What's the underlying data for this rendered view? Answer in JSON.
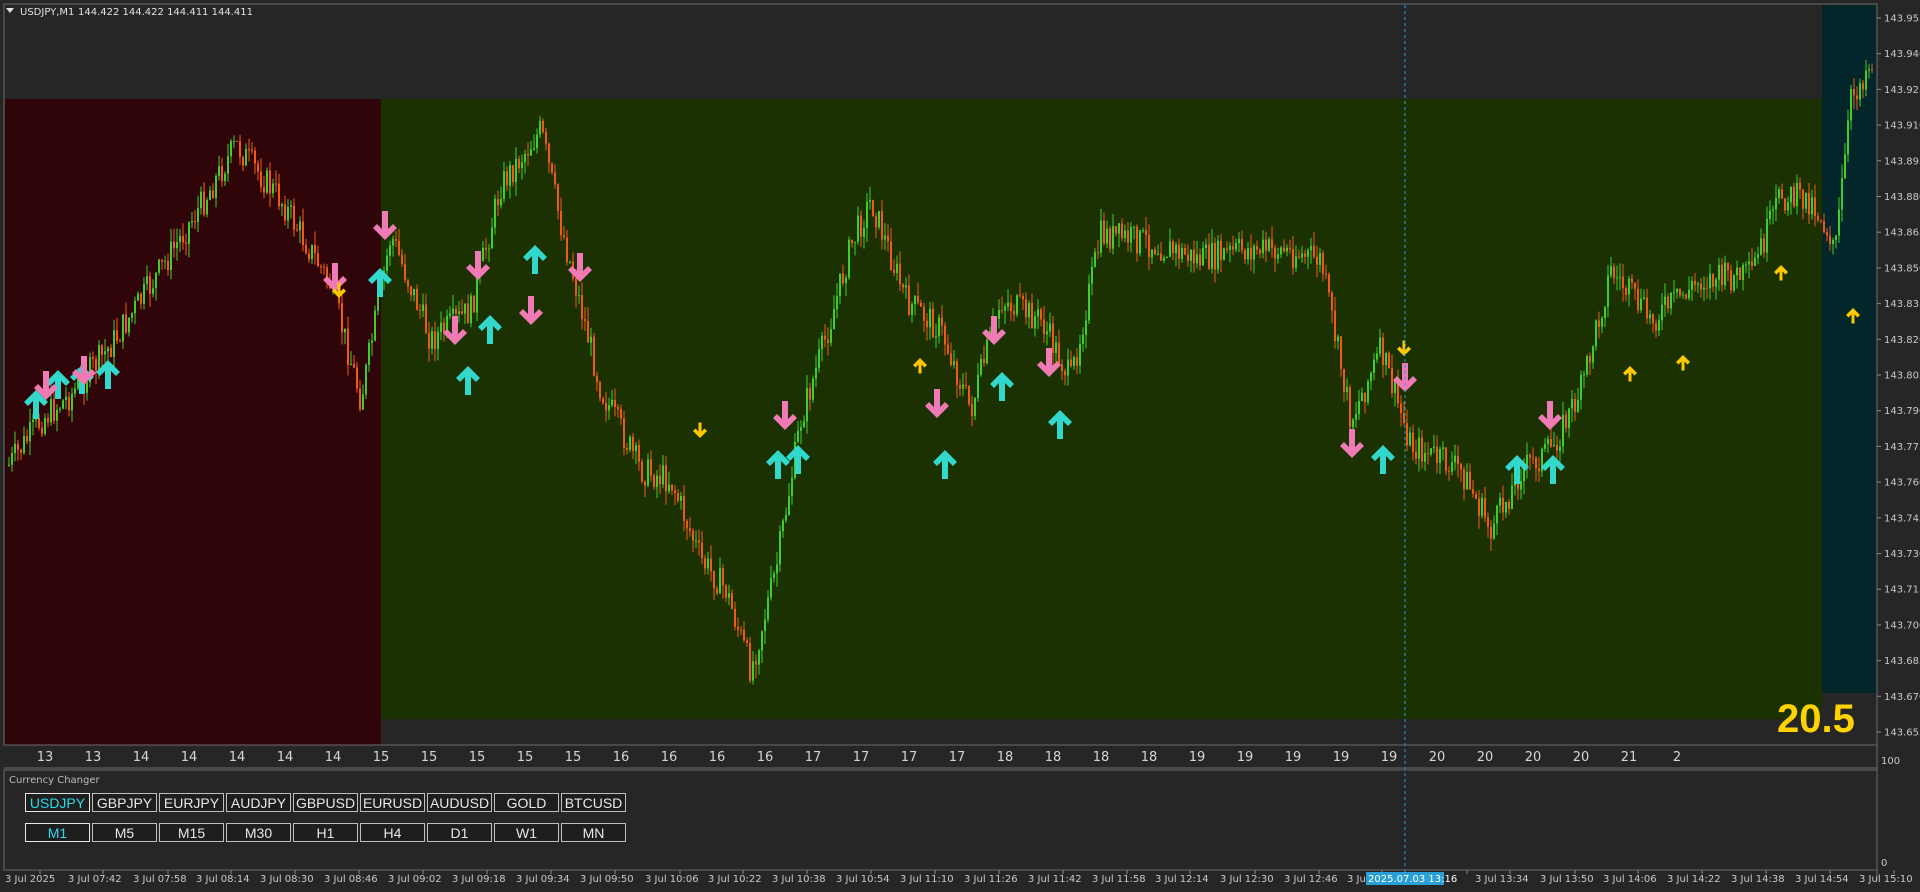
{
  "chart_header": {
    "symbol_tf": "USDJPY,M1",
    "ohlc": "144.422 144.422 144.411 144.411"
  },
  "price_axis": {
    "labels": [
      "143.955",
      "143.940",
      "143.925",
      "143.910",
      "143.895",
      "143.880",
      "143.865",
      "143.850",
      "143.835",
      "143.820",
      "143.805",
      "143.790",
      "143.775",
      "143.760",
      "143.745",
      "143.730",
      "143.715",
      "143.700",
      "143.685",
      "143.670",
      "143.655"
    ]
  },
  "strength_value": "20.5",
  "session_numbers": [
    "13",
    "13",
    "14",
    "14",
    "14",
    "14",
    "14",
    "15",
    "15",
    "15",
    "15",
    "15",
    "16",
    "16",
    "16",
    "16",
    "17",
    "17",
    "17",
    "17",
    "18",
    "18",
    "18",
    "18",
    "19",
    "19",
    "19",
    "19",
    "19",
    "20",
    "20",
    "20",
    "20",
    "21",
    "2"
  ],
  "sub_window": {
    "title": "Currency Changer",
    "axis_labels": [
      "100",
      "0"
    ],
    "pairs": [
      {
        "label": "USDJPY",
        "active": true
      },
      {
        "label": "GBPJPY",
        "active": false
      },
      {
        "label": "EURJPY",
        "active": false
      },
      {
        "label": "AUDJPY",
        "active": false
      },
      {
        "label": "GBPUSD",
        "active": false
      },
      {
        "label": "EURUSD",
        "active": false
      },
      {
        "label": "AUDUSD",
        "active": false
      },
      {
        "label": "GOLD",
        "active": false
      },
      {
        "label": "BTCUSD",
        "active": false
      }
    ],
    "timeframes": [
      {
        "label": "M1",
        "active": true
      },
      {
        "label": "M5",
        "active": false
      },
      {
        "label": "M15",
        "active": false
      },
      {
        "label": "M30",
        "active": false
      },
      {
        "label": "H1",
        "active": false
      },
      {
        "label": "H4",
        "active": false
      },
      {
        "label": "D1",
        "active": false
      },
      {
        "label": "W1",
        "active": false
      },
      {
        "label": "MN",
        "active": false
      }
    ]
  },
  "time_axis": {
    "labels": [
      "3 Jul 2025",
      "3 Jul 07:42",
      "3 Jul 07:58",
      "3 Jul 08:14",
      "3 Jul 08:30",
      "3 Jul 08:46",
      "3 Jul 09:02",
      "3 Jul 09:18",
      "3 Jul 09:34",
      "3 Jul 09:50",
      "3 Jul 10:06",
      "3 Jul 10:22",
      "3 Jul 10:38",
      "3 Jul 10:54",
      "3 Jul 11:10",
      "3 Jul 11:26",
      "3 Jul 11:42",
      "3 Jul 11:58",
      "3 Jul 12:14",
      "3 Jul 12:30",
      "3 Jul 12:46",
      "3 Ju",
      "18",
      "3 Jul 13:34",
      "3 Jul 13:50",
      "3 Jul 14:06",
      "3 Jul 14:22",
      "3 Jul 14:38",
      "3 Jul 14:54",
      "3 Jul 15:10"
    ],
    "crosshair_label": "2025.07.03 13:16"
  },
  "colors": {
    "background": "#262626",
    "zone_bearish": "#2f0509",
    "zone_bullish": "#1b3101",
    "zone_current": "#03262a",
    "candle_up": "#3fcf2c",
    "candle_down": "#f05a15",
    "arrow_buy_big": "#32d8cc",
    "arrow_sell_big": "#f07ab5",
    "arrow_small": "#ffc800",
    "crosshair": "#2a9fd6"
  }
}
